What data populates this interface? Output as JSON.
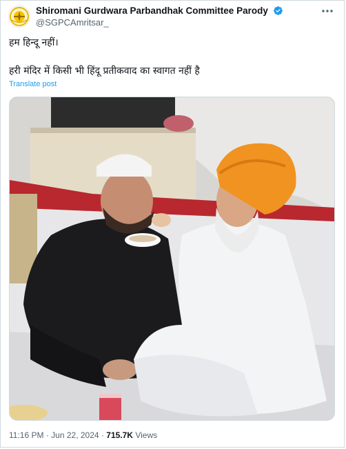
{
  "author": {
    "display_name": "Shiromani Gurdwara Parbandhak Committee Parody",
    "handle": "@SGPCAmritsar_",
    "verified": true,
    "avatar_icon": "sgpc-emblem-avatar"
  },
  "post": {
    "line1": "हम हिन्दू नहीं।",
    "line2": "हरी मंदिर में किसी भी हिंदू प्रतीकवाद का स्वागत नहीं है",
    "translate_label": "Translate post",
    "image_icon": "photo-sikh-man-feeding-man-in-skullcap"
  },
  "meta": {
    "time": "11:16 PM",
    "separator": "·",
    "date": "Jun 22, 2024",
    "views_count": "715.7K",
    "views_label": "Views"
  },
  "colors": {
    "link": "#1d9bf0",
    "verified": "#1d9bf0",
    "secondary_text": "#536471",
    "border": "#cfd9de"
  }
}
